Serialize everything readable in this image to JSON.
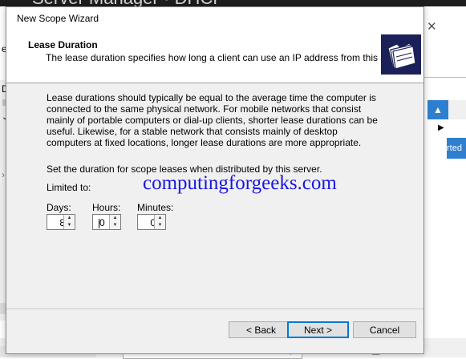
{
  "background": {
    "title": "Server Manager • DHCP",
    "filter_placeholder": "Filter",
    "left_letter": "D",
    "left_e": "e",
    "right_button_label": "rted"
  },
  "wizard": {
    "title": "New Scope Wizard",
    "heading": "Lease Duration",
    "subheading": "The lease duration specifies how long a client can use an IP address from this scope.",
    "description": "Lease durations should typically be equal to the average time the computer is connected to the same physical network. For mobile networks that consist mainly of portable computers or dial-up clients, shorter lease durations can be useful. Likewise, for a stable network that consists mainly of desktop computers at fixed locations, longer lease durations are more appropriate.",
    "set_duration_text": "Set the duration for scope leases when distributed by this server.",
    "limited_to": "Limited to:",
    "fields": {
      "days_label": "Days:",
      "days_value": "8",
      "hours_label": "Hours:",
      "hours_value": "0",
      "minutes_label": "Minutes:",
      "minutes_value": "0"
    },
    "buttons": {
      "back": "< Back",
      "next": "Next >",
      "cancel": "Cancel"
    }
  },
  "watermark": "computingforgeeks.com",
  "colors": {
    "accent": "#0078d7",
    "watermark": "#1717e0",
    "body_bg": "#f0f0f0"
  }
}
